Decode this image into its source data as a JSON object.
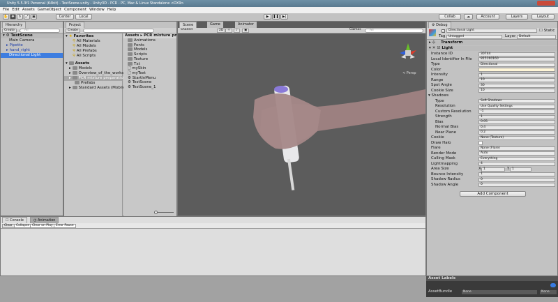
{
  "window": {
    "title": "Unity 5.5.3f1 Personal (64bit) - TestScene.unity - Unity3D - PCR - PC, Mac & Linux Standalone <DX9>"
  },
  "menu": [
    "File",
    "Edit",
    "Assets",
    "GameObject",
    "Component",
    "Window",
    "Help"
  ],
  "toolbar": {
    "center": "Center",
    "local": "Local",
    "collab": "Collab",
    "account": "Account",
    "layers": "Layers",
    "layout": "Layout"
  },
  "hierarchy": {
    "tab": "Hierarchy",
    "create": "Create",
    "search": "All",
    "scene": "TestScene",
    "items": [
      {
        "label": "Main Camera",
        "prefab": false,
        "fold": false
      },
      {
        "label": "Pipette",
        "prefab": true,
        "fold": true
      },
      {
        "label": "hand_right",
        "prefab": true,
        "fold": true
      },
      {
        "label": "Directional Light",
        "prefab": false,
        "fold": false,
        "selected": true
      }
    ]
  },
  "project": {
    "tab": "Project",
    "create": "Create",
    "favorites_label": "Favorites",
    "favorites": [
      "All Materials",
      "All Models",
      "All Prefabs",
      "All Scripts"
    ],
    "assets_label": "Assets",
    "assets": [
      "Models",
      "Overview_of_the_workspa",
      "PCR mixture preparation",
      "Prefabs",
      "Standard Assets (Mobile)"
    ],
    "breadcrumb": [
      "Assets",
      "PCR mixture prepar"
    ],
    "contents": [
      {
        "label": "Animations",
        "icon": "folder"
      },
      {
        "label": "Fonts",
        "icon": "folder"
      },
      {
        "label": "Models",
        "icon": "folder"
      },
      {
        "label": "Scripts",
        "icon": "folder"
      },
      {
        "label": "Texture",
        "icon": "folder"
      },
      {
        "label": "Txt",
        "icon": "folder"
      },
      {
        "label": "mySkin",
        "icon": "file"
      },
      {
        "label": "myText",
        "icon": "file"
      },
      {
        "label": "StartInMenu",
        "icon": "unity"
      },
      {
        "label": "TestScene",
        "icon": "unity"
      },
      {
        "label": "TestScene_1",
        "icon": "unity"
      }
    ]
  },
  "scene": {
    "tabs": [
      "Scene",
      "Game",
      "Animator"
    ],
    "shading": "Shaded",
    "mode2d": "2D",
    "gizmos": "Gizmos",
    "search": "All",
    "persp": "< Persp"
  },
  "inspector": {
    "tab": "Debug",
    "object_name": "Directional Light",
    "static": "Static",
    "tag_label": "Tag",
    "tag": "Untagged",
    "layer_label": "Layer",
    "layer": "Default",
    "transform": "Transform",
    "light": "Light",
    "props": [
      {
        "label": "Instance ID",
        "value": "30744"
      },
      {
        "label": "Local Identifier In File",
        "value": "815160160"
      },
      {
        "label": "Type",
        "value": "Directional",
        "dd": true
      },
      {
        "label": "Color",
        "value": "",
        "color": "#fff6d8"
      },
      {
        "label": "Intensity",
        "value": "1"
      },
      {
        "label": "Range",
        "value": "10"
      },
      {
        "label": "Spot Angle",
        "value": "30"
      },
      {
        "label": "Cookie Size",
        "value": "10"
      }
    ],
    "shadows_label": "Shadows",
    "shadows": [
      {
        "label": "Type",
        "value": "Soft Shadows",
        "dd": true
      },
      {
        "label": "Resolution",
        "value": "Use Quality Settings",
        "dd": true
      },
      {
        "label": "Custom Resolution",
        "value": "-1"
      },
      {
        "label": "Strength",
        "value": "1"
      },
      {
        "label": "Bias",
        "value": "0.05"
      },
      {
        "label": "Normal Bias",
        "value": "0.4"
      },
      {
        "label": "Near Plane",
        "value": "0.2"
      }
    ],
    "props2": [
      {
        "label": "Cookie",
        "value": "None (Texture)"
      },
      {
        "label": "Draw Halo",
        "value": ""
      },
      {
        "label": "Flare",
        "value": "None (Flare)"
      },
      {
        "label": "Render Mode",
        "value": "Auto",
        "dd": true
      },
      {
        "label": "Culling Mask",
        "value": "Everything",
        "dd": true
      },
      {
        "label": "Lightmapping",
        "value": "4"
      }
    ],
    "area_size": {
      "label": "Area Size",
      "x_label": "X",
      "x": "1",
      "y_label": "Y",
      "y": "1"
    },
    "props3": [
      {
        "label": "Bounce Intensity",
        "value": "1"
      },
      {
        "label": "Shadow Radius",
        "value": "0"
      },
      {
        "label": "Shadow Angle",
        "value": "0"
      }
    ],
    "add_component": "Add Component",
    "asset_labels": "Asset Labels",
    "assetbundle_label": "AssetBundle",
    "assetbundle": "None",
    "variant": "None"
  },
  "console": {
    "tabs": [
      "Console",
      "Animation"
    ],
    "buttons": [
      "Clear",
      "Collapse",
      "Clear on Play",
      "Error Pause"
    ]
  },
  "colors": {
    "selection": "#3d7de0",
    "panel": "#c2c2c2",
    "scene_bg": "#5c5c5c"
  }
}
